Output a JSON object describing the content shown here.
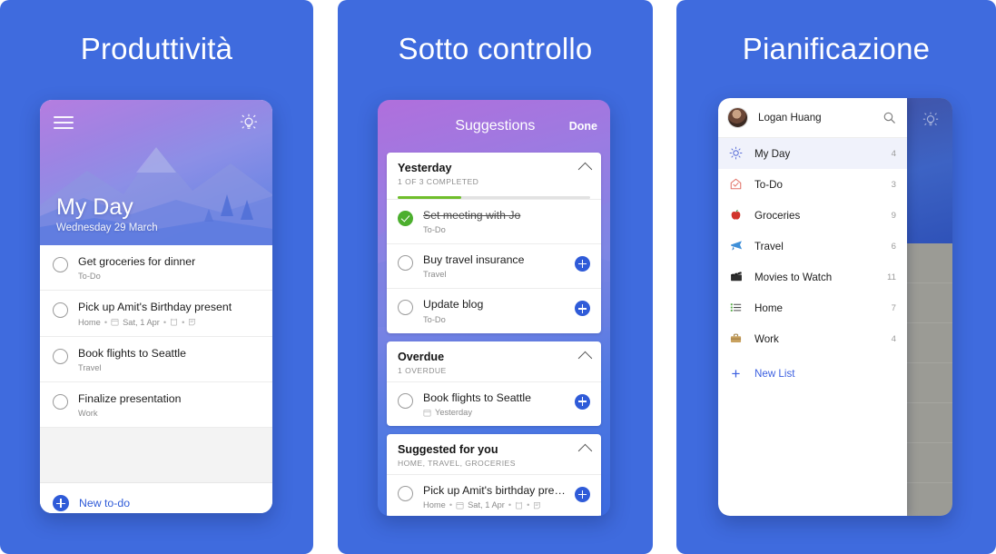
{
  "panels": [
    {
      "title": "Produttività"
    },
    {
      "title": "Sotto controllo"
    },
    {
      "title": "Pianificazione"
    }
  ],
  "myday": {
    "hero": {
      "title": "My Day",
      "date": "Wednesday 29 March"
    },
    "menu_icon": "hamburger-icon",
    "suggestions_icon": "lightbulb-icon",
    "tasks": [
      {
        "title": "Get groceries for dinner",
        "meta": "To-Do",
        "icons": []
      },
      {
        "title": "Pick up Amit's Birthday present",
        "meta": "Home",
        "date": "Sat, 1 Apr",
        "icons": [
          "calendar-icon",
          "reminder-icon",
          "note-icon"
        ]
      },
      {
        "title": "Book flights to Seattle",
        "meta": "Travel",
        "icons": []
      },
      {
        "title": "Finalize presentation",
        "meta": "Work",
        "icons": []
      }
    ],
    "new_todo_label": "New to-do"
  },
  "suggestions": {
    "header_title": "Suggestions",
    "done_label": "Done",
    "groups": [
      {
        "title": "Yesterday",
        "subtitle": "1 OF 3 COMPLETED",
        "progress_pct": 33,
        "tasks": [
          {
            "title": "Set meeting with Jo",
            "meta": "To-Do",
            "completed": true,
            "addable": false
          },
          {
            "title": "Buy travel insurance",
            "meta": "Travel",
            "completed": false,
            "addable": true
          },
          {
            "title": "Update blog",
            "meta": "To-Do",
            "completed": false,
            "addable": true
          }
        ]
      },
      {
        "title": "Overdue",
        "subtitle": "1 OVERDUE",
        "progress_pct": null,
        "tasks": [
          {
            "title": "Book flights to Seattle",
            "meta": "Yesterday",
            "date_icon": true,
            "completed": false,
            "addable": true
          }
        ]
      },
      {
        "title": "Suggested for you",
        "subtitle": "HOME, TRAVEL, GROCERIES",
        "progress_pct": null,
        "tasks": [
          {
            "title": "Pick up Amit's birthday present",
            "meta": "Home",
            "date": "Sat, 1 Apr",
            "icons": [
              "calendar-icon",
              "reminder-icon",
              "note-icon"
            ],
            "completed": false,
            "addable": true
          }
        ]
      }
    ]
  },
  "drawer": {
    "user_name": "Logan Huang",
    "search_icon": "search-icon",
    "avatar": "user-avatar",
    "items": [
      {
        "label": "My Day",
        "count": "4",
        "icon": "sun-icon",
        "glyph": "☀",
        "color": "#5B6FD8",
        "active": true
      },
      {
        "label": "To-Do",
        "count": "3",
        "icon": "home-check-icon",
        "glyph": "⌂",
        "color": "#E2756B",
        "active": false
      },
      {
        "label": "Groceries",
        "count": "9",
        "icon": "apple-icon",
        "glyph": "🍎",
        "color": "#D1352B",
        "active": false
      },
      {
        "label": "Travel",
        "count": "6",
        "icon": "airplane-icon",
        "glyph": "✈",
        "color": "#3F8FD8",
        "active": false
      },
      {
        "label": "Movies to Watch",
        "count": "11",
        "icon": "clapperboard-icon",
        "glyph": "🎬",
        "color": "#3A3A3A",
        "active": false
      },
      {
        "label": "Home",
        "count": "7",
        "icon": "list-icon",
        "glyph": "☰",
        "color": "#5AAE4B",
        "active": false
      },
      {
        "label": "Work",
        "count": "4",
        "icon": "briefcase-icon",
        "glyph": "💼",
        "color": "#C8A15E",
        "active": false
      }
    ],
    "new_list_label": "New List"
  },
  "colors": {
    "brand_blue": "#3F6BDE",
    "accent_blue": "#2F5BD8",
    "link_blue": "#3B5FE0",
    "progress_green": "#6FBE2B",
    "complete_green": "#4CAF2E",
    "active_row": "#F0F2FB"
  }
}
